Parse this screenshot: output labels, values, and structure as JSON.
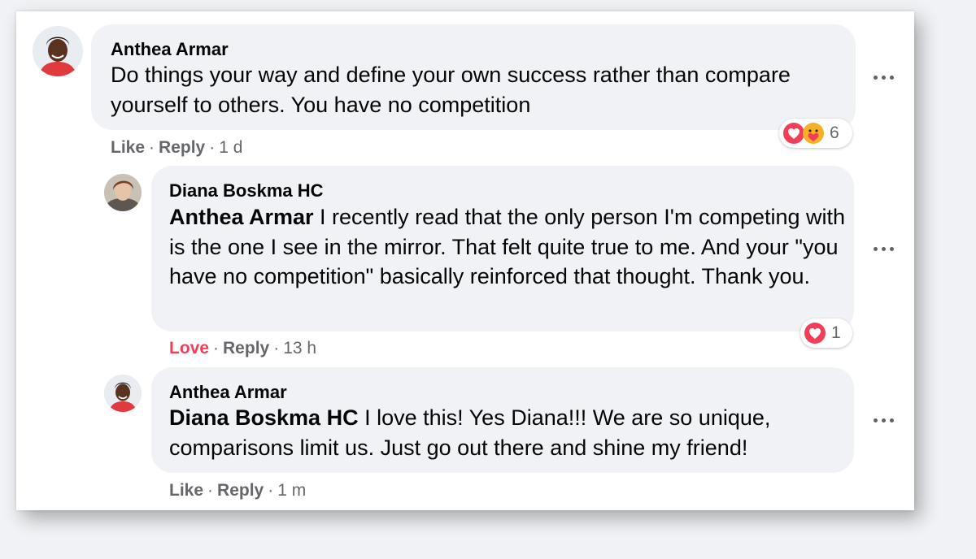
{
  "comments": [
    {
      "author": "Anthea Armar",
      "text": "Do things your way and define your own success rather than compare yourself to others. You have no competition",
      "actions": {
        "like": "Like",
        "reply": "Reply",
        "time": "1 d"
      },
      "reactions": {
        "types": [
          "love-icon",
          "care-icon"
        ],
        "count": "6"
      }
    },
    {
      "author": "Diana Boskma HC",
      "mention": "Anthea Armar",
      "text": " I recently read that the only person I'm competing with is the one I see in the mirror. That felt quite true to me. And your \"you have no competition\" basically reinforced that thought. Thank you.",
      "actions": {
        "like": "Love",
        "reply": "Reply",
        "time": "13 h"
      },
      "reactions": {
        "types": [
          "love-icon"
        ],
        "count": "1"
      }
    },
    {
      "author": "Anthea Armar",
      "mention": "Diana Boskma HC",
      "text": " I love this! Yes Diana!!! We are so unique, comparisons limit us. Just go out there and shine my friend!",
      "actions": {
        "like": "Like",
        "reply": "Reply",
        "time": "1 m"
      }
    }
  ],
  "separator": "·",
  "colors": {
    "page_background": "#ffffff",
    "bubble": "#f0f2f5",
    "text": "#050505",
    "secondary": "#65676b",
    "love_accent": "#f33e58"
  }
}
